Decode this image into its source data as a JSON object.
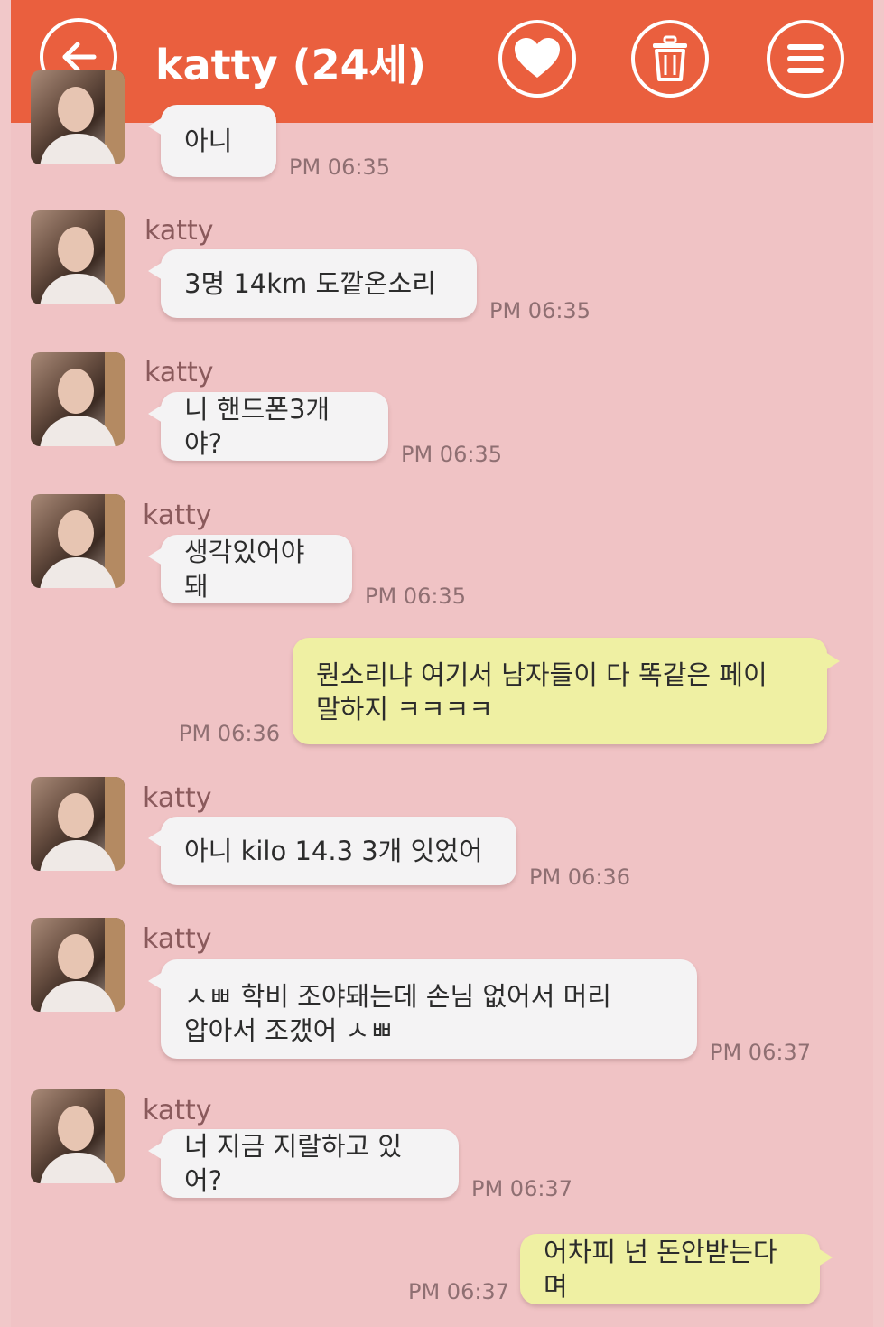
{
  "header": {
    "title": "katty (24세)",
    "back_icon": "back-arrow-icon",
    "heart_icon": "heart-icon",
    "trash_icon": "trash-icon",
    "menu_icon": "menu-icon",
    "color": "#ea5f3e"
  },
  "messages": [
    {
      "from": "katty",
      "side": "in",
      "show_sender": false,
      "text": "아니",
      "time": "PM 06:35"
    },
    {
      "from": "katty",
      "side": "in",
      "show_sender": true,
      "text": "3명  14km   도깥온소리",
      "time": "PM 06:35"
    },
    {
      "from": "katty",
      "side": "in",
      "show_sender": true,
      "text": "니 핸드폰3개야?",
      "time": "PM 06:35"
    },
    {
      "from": "katty",
      "side": "in",
      "show_sender": true,
      "text": "생각있어야돼",
      "time": "PM 06:35"
    },
    {
      "from": "me",
      "side": "out",
      "text": "뭔소리냐 여기서 남자들이 다 똑같은 페이\n말하지 ㅋㅋㅋㅋ",
      "time": "PM 06:36"
    },
    {
      "from": "katty",
      "side": "in",
      "show_sender": true,
      "text": "아니  kilo  14.3 3개  잇었어",
      "time": "PM 06:36"
    },
    {
      "from": "katty",
      "side": "in",
      "show_sender": true,
      "text": "ㅅㅃ  학비 조야돼는데  손님 없어서 머리\n압아서 조갰어 ㅅㅃ",
      "time": "PM 06:37"
    },
    {
      "from": "katty",
      "side": "in",
      "show_sender": true,
      "text": "너 지금 지랄하고 있어?",
      "time": "PM 06:37"
    },
    {
      "from": "me",
      "side": "out",
      "text": "어차피 넌 돈안받는다며",
      "time": "PM 06:37"
    }
  ]
}
